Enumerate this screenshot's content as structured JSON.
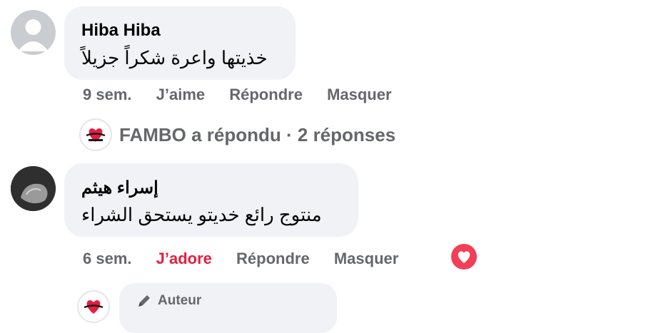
{
  "comments": [
    {
      "author": "Hiba Hiba",
      "text": "خذيتها واعرة شكراً جزيلاً",
      "time": "9 sem.",
      "react": "J’aime",
      "reply": "Répondre",
      "hide": "Masquer",
      "react_color": "#65676b"
    },
    {
      "author": "إسراء هيثم",
      "text": "منتوج رائع خديتو يستحق الشراء",
      "time": "6 sem.",
      "react": "J’adore",
      "reply": "Répondre",
      "hide": "Masquer",
      "react_color": "#e41e3f"
    }
  ],
  "replies_summary": {
    "text": "FAMBO a répondu · 2 réponses"
  },
  "author_reply": {
    "badge": "Auteur"
  },
  "icons": {
    "default_avatar": "default-avatar-icon",
    "page_logo": "fambo-logo-icon",
    "love_reaction": "heart-reaction-icon",
    "pencil": "pencil-icon"
  },
  "colors": {
    "bubble": "#f0f2f5",
    "meta": "#65676b",
    "love": "#e41e3f"
  }
}
